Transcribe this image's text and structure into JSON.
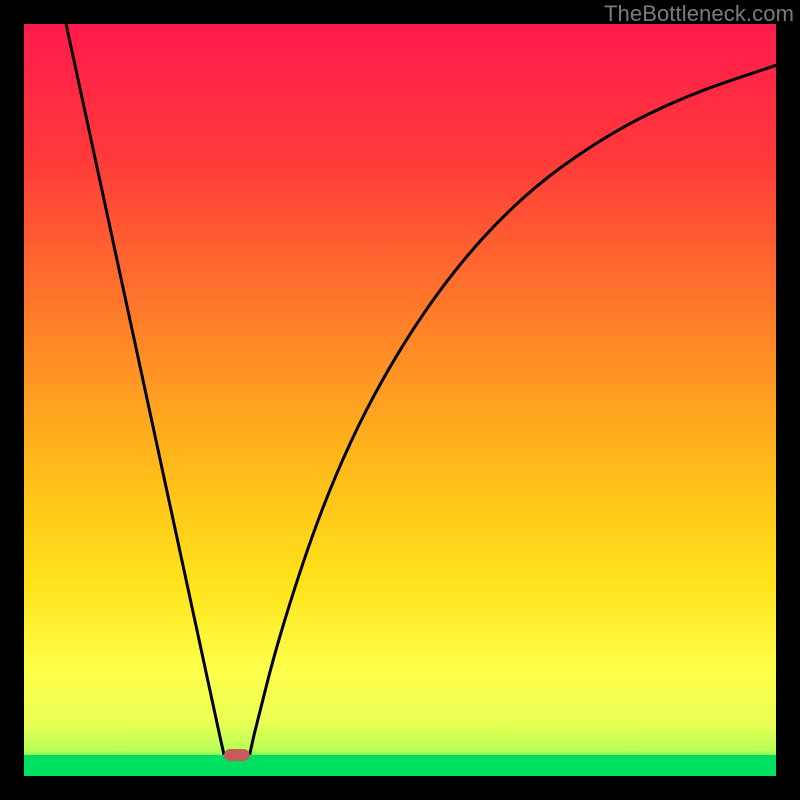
{
  "attribution": "TheBottleneck.com",
  "chart_data": {
    "type": "line",
    "title": "",
    "xlabel": "",
    "ylabel": "",
    "xlim": [
      0,
      1
    ],
    "ylim": [
      0,
      1
    ],
    "background_gradient": {
      "top": "#ff1a4c",
      "mid1": "#ff7a2a",
      "mid2": "#ffd21a",
      "mid3": "#ffff4a",
      "bottom": "#00e060"
    },
    "series": [
      {
        "name": "curve",
        "type": "line",
        "points": [
          {
            "x": 0.056,
            "y": 1.0
          },
          {
            "x": 0.26,
            "y": 0.055
          },
          {
            "x": 0.266,
            "y": 0.028
          },
          {
            "x": 0.3,
            "y": 0.028
          },
          {
            "x": 0.306,
            "y": 0.055
          },
          {
            "x": 0.34,
            "y": 0.19
          },
          {
            "x": 0.4,
            "y": 0.37
          },
          {
            "x": 0.47,
            "y": 0.52
          },
          {
            "x": 0.56,
            "y": 0.66
          },
          {
            "x": 0.66,
            "y": 0.77
          },
          {
            "x": 0.77,
            "y": 0.85
          },
          {
            "x": 0.88,
            "y": 0.905
          },
          {
            "x": 1.0,
            "y": 0.945
          }
        ]
      },
      {
        "name": "bottom-band-green",
        "type": "area",
        "y_top": 0.028,
        "y_bottom": 0.0,
        "color": "#00e060"
      },
      {
        "name": "marker",
        "type": "marker",
        "x0": 0.266,
        "x1": 0.3,
        "y": 0.028,
        "color": "#c75a5a"
      }
    ]
  }
}
